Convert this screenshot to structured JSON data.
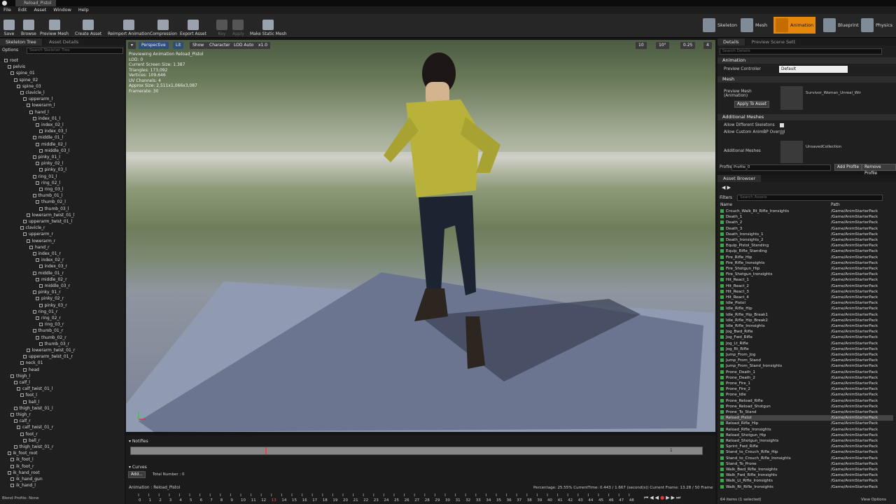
{
  "window": {
    "title": "Reload_Pistol"
  },
  "menu": [
    "File",
    "Edit",
    "Asset",
    "Window",
    "Help"
  ],
  "toolbar": [
    {
      "label": "Save",
      "icon": "save-icon"
    },
    {
      "label": "Browse",
      "icon": "browse-icon"
    },
    {
      "label": "Preview Mesh",
      "icon": "preview-mesh-icon"
    },
    {
      "label": "Create Asset",
      "icon": "create-asset-icon"
    },
    {
      "label": "Reimport Animation",
      "icon": "reimport-icon"
    },
    {
      "label": "Compression",
      "icon": "compression-icon"
    },
    {
      "label": "Export Asset",
      "icon": "export-icon"
    },
    {
      "label": "Key",
      "icon": "key-icon"
    },
    {
      "label": "Apply",
      "icon": "apply-icon"
    },
    {
      "label": "Make Static Mesh",
      "icon": "static-mesh-icon"
    }
  ],
  "modes": [
    "Skeleton",
    "Mesh",
    "Animation",
    "Blueprint",
    "Physics"
  ],
  "skeleton_tree": {
    "tabs": [
      "Skeleton Tree",
      "Asset Details"
    ],
    "options_label": "Options",
    "search_placeholder": "Search Skeleton Tree",
    "bones": [
      "root",
      "pelvis",
      "spine_01",
      "spine_02",
      "spine_03",
      "clavicle_l",
      "upperarm_l",
      "lowerarm_l",
      "hand_l",
      "index_01_l",
      "index_02_l",
      "index_03_l",
      "middle_01_l",
      "middle_02_l",
      "middle_03_l",
      "pinky_01_l",
      "pinky_02_l",
      "pinky_03_l",
      "ring_01_l",
      "ring_02_l",
      "ring_03_l",
      "thumb_01_l",
      "thumb_02_l",
      "thumb_03_l",
      "lowerarm_twist_01_l",
      "upperarm_twist_01_l",
      "clavicle_r",
      "upperarm_r",
      "lowerarm_r",
      "hand_r",
      "index_01_r",
      "index_02_r",
      "index_03_r",
      "middle_01_r",
      "middle_02_r",
      "middle_03_r",
      "pinky_01_r",
      "pinky_02_r",
      "pinky_03_r",
      "ring_01_r",
      "ring_02_r",
      "ring_03_r",
      "thumb_01_r",
      "thumb_02_r",
      "thumb_03_r",
      "lowerarm_twist_01_r",
      "upperarm_twist_01_r",
      "neck_01",
      "head",
      "thigh_l",
      "calf_l",
      "calf_twist_01_l",
      "foot_l",
      "ball_l",
      "thigh_twist_01_l",
      "thigh_r",
      "calf_r",
      "calf_twist_01_r",
      "foot_r",
      "ball_r",
      "thigh_twist_01_r",
      "ik_foot_root",
      "ik_foot_l",
      "ik_foot_r",
      "ik_hand_root",
      "ik_hand_gun",
      "ik_hand_l"
    ],
    "blend_profile": "Blend Profile: None"
  },
  "viewport": {
    "buttons": [
      "Perspective",
      "Lit",
      "Show",
      "Character",
      "LOD Auto",
      "x1.0"
    ],
    "right_values": [
      "10",
      "10°",
      "0.25",
      "4"
    ],
    "stats": [
      "Previewing Animation Reload_Pistol",
      "LOD: 0",
      "Current Screen Size: 1.387",
      "Triangles: 173,092",
      "Vertices: 109,646",
      "UV Channels: 4",
      "Approx Size: 2,511x1,066x3,087",
      "Framerate: 30"
    ]
  },
  "notifies": {
    "label": "Notifies",
    "track_index": "1",
    "curves_label": "Curves",
    "add_label": "Add...",
    "total_number": "Total Number : 0",
    "animation_label": "Animation : Reload_Pistol",
    "status": "Percentage: 25.55% CurrentTime: 0.443 / 1.667 (second(s)) Current Frame: 13.28 / 50 Frame",
    "frames": [
      "0",
      "1",
      "2",
      "3",
      "4",
      "5",
      "6",
      "7",
      "8",
      "9",
      "10",
      "11",
      "12",
      "13",
      "14",
      "15",
      "16",
      "17",
      "18",
      "19",
      "20",
      "21",
      "22",
      "23",
      "24",
      "25",
      "26",
      "27",
      "28",
      "29",
      "30",
      "31",
      "32",
      "33",
      "34",
      "35",
      "36",
      "37",
      "38",
      "39",
      "40",
      "41",
      "42",
      "43",
      "44",
      "45",
      "46",
      "47",
      "48"
    ]
  },
  "details": {
    "tabs": [
      "Details",
      "Preview Scene Sett"
    ],
    "search_placeholder": "Search Details",
    "animation_header": "Animation",
    "preview_controller_label": "Preview Controller",
    "preview_controller_value": "Default",
    "mesh_header": "Mesh",
    "preview_mesh_label": "Preview Mesh (Animation)",
    "preview_mesh_value": "Survivor_Woman_Unreal_Wir",
    "apply_to_asset": "Apply To Asset",
    "additional_meshes_header": "Additional Meshes",
    "allow_diff_skeletons": "Allow Different Skeletons",
    "allow_custom_animbp": "Allow Custom AnimBP Overrid",
    "additional_meshes_label": "Additional Meshes",
    "unsaved_collection": "UnsavedCollection",
    "profile_label": "Profile",
    "profile_value": "Profile_0",
    "add_profile": "Add Profile",
    "remove_profile": "Remove Profile"
  },
  "asset_browser": {
    "tab": "Asset Browser",
    "filters_label": "Filters",
    "search_placeholder": "Search Assets",
    "col_name": "Name",
    "col_path": "Path",
    "selected": "Reload_Pistol",
    "assets": [
      "Crouch_Walk_Rt_Rifle_Ironsights",
      "Death_1",
      "Death_2",
      "Death_3",
      "Death_Ironsights_1",
      "Death_Ironsights_2",
      "Equip_Pistol_Standing",
      "Equip_Rifle_Standing",
      "Fire_Rifle_Hip",
      "Fire_Rifle_Ironsights",
      "Fire_Shotgun_Hip",
      "Fire_Shotgun_Ironsights",
      "Hit_React_1",
      "Hit_React_2",
      "Hit_React_3",
      "Hit_React_4",
      "Idle_Pistol",
      "Idle_Rifle_Hip",
      "Idle_Rifle_Hip_Break1",
      "Idle_Rifle_Hip_Break2",
      "Idle_Rifle_Ironsights",
      "Jog_Bwd_Rifle",
      "Jog_Fwd_Rifle",
      "Jog_Lt_Rifle",
      "Jog_Rt_Rifle",
      "Jump_From_Jog",
      "Jump_From_Stand",
      "Jump_From_Stand_Ironsights",
      "Prone_Death_1",
      "Prone_Death_2",
      "Prone_Fire_1",
      "Prone_Fire_2",
      "Prone_Idle",
      "Prone_Reload_Rifle",
      "Prone_Reload_Shotgun",
      "Prone_To_Stand",
      "Reload_Pistol",
      "Reload_Rifle_Hip",
      "Reload_Rifle_Ironsights",
      "Reload_Shotgun_Hip",
      "Reload_Shotgun_Ironsights",
      "Sprint_Fwd_Rifle",
      "Stand_to_Crouch_Rifle_Hip",
      "Stand_to_Crouch_Rifle_Ironsights",
      "Stand_To_Prone",
      "Walk_Bwd_Rifle_Ironsights",
      "Walk_Fwd_Rifle_Ironsights",
      "Walk_Lt_Rifle_Ironsights",
      "Walk_Rt_Rifle_Ironsights"
    ],
    "path": "/Game/AnimStarterPack",
    "count": "64 items (1 selected)",
    "view_options": "View Options"
  },
  "colors": {
    "accent": "#e5870a",
    "selection": "#2d4f77"
  }
}
